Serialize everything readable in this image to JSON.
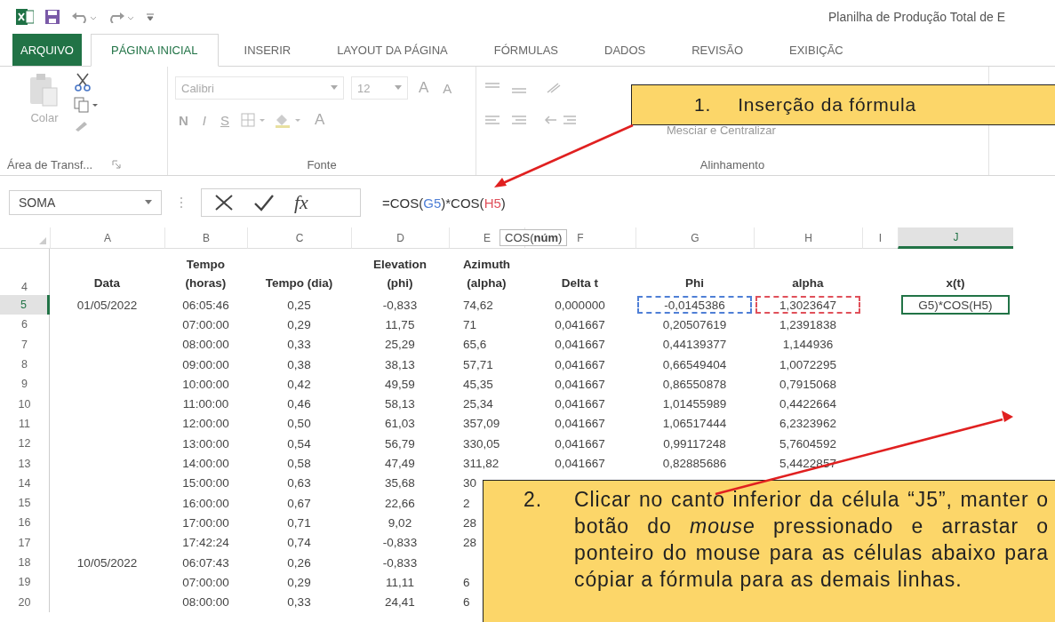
{
  "title": "Planilha de Produção Total de E",
  "tabs": [
    {
      "label": "ARQUIVO",
      "kind": "file",
      "selected": false
    },
    {
      "label": "PÁGINA INICIAL",
      "kind": "tab",
      "selected": true
    },
    {
      "label": "INSERIR",
      "kind": "tab",
      "selected": false
    },
    {
      "label": "LAYOUT DA PÁGINA",
      "kind": "tab",
      "selected": false
    },
    {
      "label": "FÓRMULAS",
      "kind": "tab",
      "selected": false
    },
    {
      "label": "DADOS",
      "kind": "tab",
      "selected": false
    },
    {
      "label": "REVISÃO",
      "kind": "tab",
      "selected": false
    },
    {
      "label": "EXIBIÇÃC",
      "kind": "tab",
      "selected": false
    }
  ],
  "ribbon": {
    "clipboard": {
      "paste": "Colar",
      "label": "Área de Transf..."
    },
    "font": {
      "name": "Calibri",
      "size": "12",
      "grow": "A",
      "shrink": "A",
      "bold": "N",
      "italic": "I",
      "underline": "S",
      "color_letter": "A",
      "label": "Fonte"
    },
    "alignment": {
      "merge": "Mesciar e Centralizar",
      "label": "Alinhamento"
    }
  },
  "formula_bar": {
    "name_box": "SOMA",
    "fx": "fx",
    "parts": [
      {
        "text": "=COS("
      },
      {
        "text": "G5",
        "color": "#4f7fd6"
      },
      {
        "text": ")*COS("
      },
      {
        "text": "H5",
        "color": "#e0505a"
      },
      {
        "text": ")"
      }
    ],
    "tooltip": "COS(**núm**)"
  },
  "sheet": {
    "columns": [
      {
        "label": "A",
        "selected": false
      },
      {
        "label": "B",
        "selected": false
      },
      {
        "label": "C",
        "selected": false
      },
      {
        "label": "D",
        "selected": false
      },
      {
        "label": "E",
        "selected": false
      },
      {
        "label": "F",
        "selected": false
      },
      {
        "label": "G",
        "selected": false
      },
      {
        "label": "H",
        "selected": false
      },
      {
        "label": "I",
        "selected": false
      },
      {
        "label": "J",
        "selected": true
      }
    ],
    "header_row": {
      "num": "4",
      "cells": {
        "A": "Data",
        "B": "Tempo\n(horas)",
        "C": "Tempo (dia)",
        "D": "Elevation\n(phi)",
        "E": "Azimuth\n(alpha)",
        "F": "Delta t",
        "G": "Phi",
        "H": "alpha",
        "J": "x(t)"
      }
    },
    "rows": [
      {
        "num": "5",
        "selected": true,
        "cells": {
          "A": "01/05/2022",
          "B": "06:05:46",
          "C": "0,25",
          "D": "-0,833",
          "E": "74,62",
          "F": "0,000000",
          "G": {
            "text": "-0,0145386",
            "color": "#4f7fd6"
          },
          "H": {
            "text": "1,3023647",
            "color": "#e0505a"
          },
          "J": {
            "text": "G5)*COS(H5)",
            "active": true
          }
        }
      },
      {
        "num": "6",
        "selected": false,
        "cells": {
          "B": "07:00:00",
          "C": "0,29",
          "D": "11,75",
          "E": "71",
          "F": "0,041667",
          "G": "0,20507619",
          "H": "1,2391838"
        }
      },
      {
        "num": "7",
        "selected": false,
        "cells": {
          "B": "08:00:00",
          "C": "0,33",
          "D": "25,29",
          "E": "65,6",
          "F": "0,041667",
          "G": "0,44139377",
          "H": "1,144936"
        }
      },
      {
        "num": "8",
        "selected": false,
        "cells": {
          "B": "09:00:00",
          "C": "0,38",
          "D": "38,13",
          "E": "57,71",
          "F": "0,041667",
          "G": "0,66549404",
          "H": "1,0072295"
        }
      },
      {
        "num": "9",
        "selected": false,
        "cells": {
          "B": "10:00:00",
          "C": "0,42",
          "D": "49,59",
          "E": "45,35",
          "F": "0,041667",
          "G": "0,86550878",
          "H": "0,7915068"
        }
      },
      {
        "num": "10",
        "selected": false,
        "cells": {
          "B": "11:00:00",
          "C": "0,46",
          "D": "58,13",
          "E": "25,34",
          "F": "0,041667",
          "G": "1,01455989",
          "H": "0,4422664"
        }
      },
      {
        "num": "11",
        "selected": false,
        "cells": {
          "B": "12:00:00",
          "C": "0,50",
          "D": "61,03",
          "E": "357,09",
          "F": "0,041667",
          "G": "1,06517444",
          "H": "6,2323962"
        }
      },
      {
        "num": "12",
        "selected": false,
        "cells": {
          "B": "13:00:00",
          "C": "0,54",
          "D": "56,79",
          "E": "330,05",
          "F": "0,041667",
          "G": "0,99117248",
          "H": "5,7604592"
        }
      },
      {
        "num": "13",
        "selected": false,
        "cells": {
          "B": "14:00:00",
          "C": "0,58",
          "D": "47,49",
          "E": "311,82",
          "F": "0,041667",
          "G": "0,82885686",
          "H": "5,4422857"
        }
      },
      {
        "num": "14",
        "selected": false,
        "cells": {
          "B": "15:00:00",
          "C": "0,63",
          "D": "35,68",
          "E": "30"
        }
      },
      {
        "num": "15",
        "selected": false,
        "cells": {
          "B": "16:00:00",
          "C": "0,67",
          "D": "22,66",
          "E": "2"
        }
      },
      {
        "num": "16",
        "selected": false,
        "cells": {
          "B": "17:00:00",
          "C": "0,71",
          "D": "9,02",
          "E": "28"
        }
      },
      {
        "num": "17",
        "selected": false,
        "cells": {
          "B": "17:42:24",
          "C": "0,74",
          "D": "-0,833",
          "E": "28"
        }
      },
      {
        "num": "18",
        "selected": false,
        "cells": {
          "A": "10/05/2022",
          "B": "06:07:43",
          "C": "0,26",
          "D": "-0,833"
        }
      },
      {
        "num": "19",
        "selected": false,
        "cells": {
          "B": "07:00:00",
          "C": "0,29",
          "D": "11,11",
          "E": "6"
        }
      },
      {
        "num": "20",
        "selected": false,
        "cells": {
          "B": "08:00:00",
          "C": "0,33",
          "D": "24,41",
          "E": "6"
        }
      }
    ]
  },
  "callouts": [
    {
      "number": "1.",
      "text": "Inserção da fórmula"
    },
    {
      "number": "2.",
      "text": "Clicar no canto inferior da célula “J5”, manter o botão do *mouse* pressionado e arrastar o ponteiro do mouse para as células abaixo para cópiar a fórmula para as demais linhas."
    }
  ]
}
